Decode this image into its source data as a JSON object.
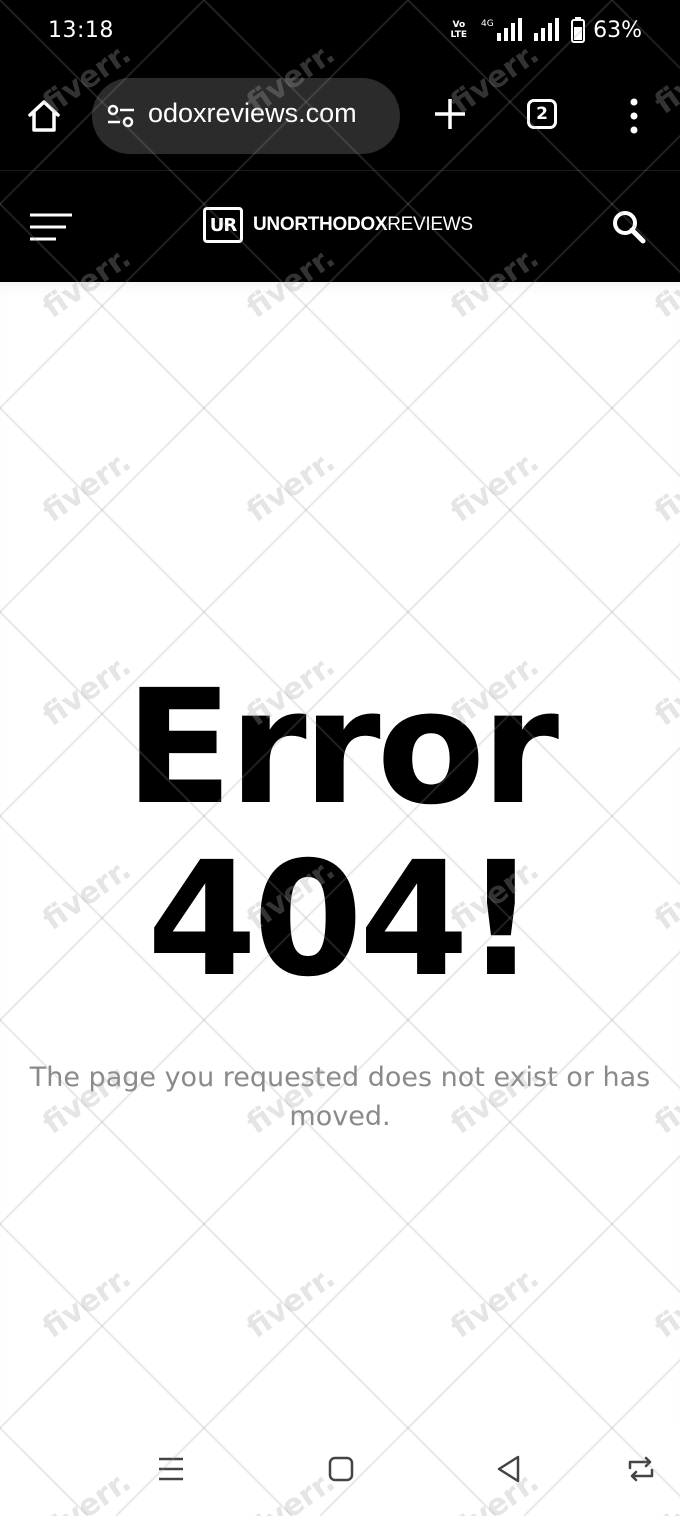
{
  "status_bar": {
    "time": "13:18",
    "volte_line1": "Vo",
    "volte_line2": "LTE",
    "network": "4G",
    "battery": "63%"
  },
  "browser": {
    "url": "odoxreviews.com",
    "tab_count": "2",
    "icons": [
      "home-icon",
      "tune-icon",
      "plus-icon",
      "tabs-icon",
      "more-vert-icon"
    ]
  },
  "site": {
    "logo_mark": "UR",
    "logo_bold": "UNORTHODOX",
    "logo_light": "REVIEWS",
    "icons": [
      "hamburger-icon",
      "search-icon"
    ]
  },
  "error": {
    "line1": "Error",
    "line2": "404!",
    "message": "The page you requested does not exist or has moved."
  },
  "watermark": "fiverr.",
  "nav_bar": {
    "icons": [
      "recents-icon",
      "home-square-icon",
      "back-icon",
      "rotate-icon"
    ]
  },
  "colors": {
    "header_bg": "#000000",
    "omnibox_bg": "#2b2b2b",
    "message_text": "#8a8a8a"
  }
}
